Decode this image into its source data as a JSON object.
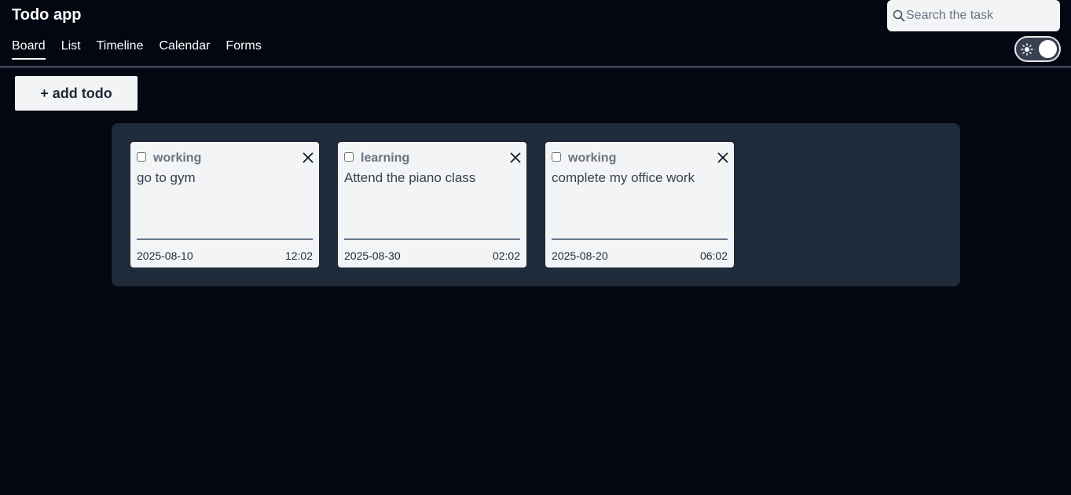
{
  "app": {
    "title": "Todo app"
  },
  "nav": {
    "tabs": [
      {
        "label": "Board",
        "active": true
      },
      {
        "label": "List",
        "active": false
      },
      {
        "label": "Timeline",
        "active": false
      },
      {
        "label": "Calendar",
        "active": false
      },
      {
        "label": "Forms",
        "active": false
      }
    ]
  },
  "search": {
    "placeholder": "Search the task",
    "value": "",
    "icon": "search-icon"
  },
  "theme_toggle": {
    "icon": "sun-icon",
    "state": "dark"
  },
  "toolbar": {
    "add_label": "+ add todo"
  },
  "board": {
    "cards": [
      {
        "category": "working",
        "text": "go to gym",
        "date": "2025-08-10",
        "time": "12:02",
        "done": false
      },
      {
        "category": "learning",
        "text": "Attend the piano class",
        "date": "2025-08-30",
        "time": "02:02",
        "done": false
      },
      {
        "category": "working",
        "text": "complete my office work",
        "date": "2025-08-20",
        "time": "06:02",
        "done": false
      }
    ]
  },
  "colors": {
    "background": "#030712",
    "board": "#1f2a3a",
    "card": "#f3f4f6",
    "category": "#6b7280"
  }
}
